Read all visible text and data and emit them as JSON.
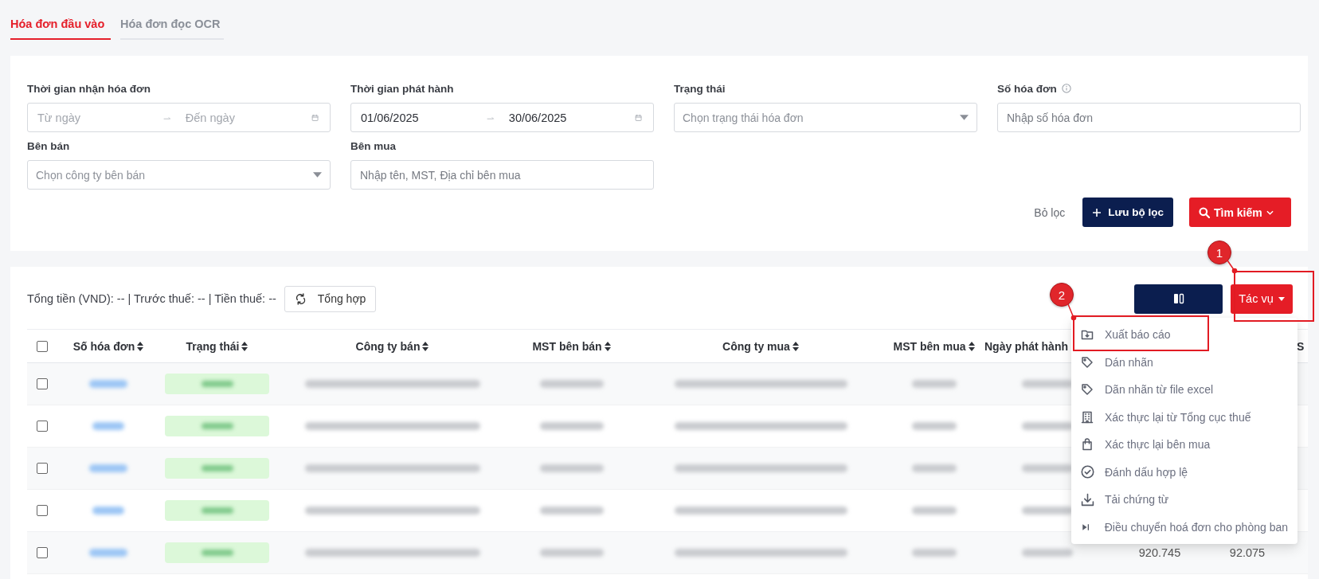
{
  "tabs": [
    {
      "label": "Hóa đơn đầu vào",
      "selected": true
    },
    {
      "label": "Hóa đơn đọc OCR",
      "selected": false
    }
  ],
  "filters": [
    {
      "label": "Thời gian nhận hóa đơn",
      "kind": "daterange",
      "from": {
        "placeholder": "Từ ngày"
      },
      "to": {
        "placeholder": "Đến ngày"
      }
    },
    {
      "label": "Thời gian phát hành",
      "kind": "daterange",
      "from": {
        "value": "01/06/2025"
      },
      "to": {
        "value": "30/06/2025"
      }
    },
    {
      "label": "Trạng thái",
      "kind": "select",
      "placeholder": "Chọn trạng thái hóa đơn"
    },
    {
      "label": "Số hóa đơn",
      "kind": "text",
      "placeholder": "Nhập số hóa đơn",
      "info_icon": true
    },
    {
      "label": "Bên bán",
      "kind": "select",
      "placeholder": "Chọn công ty bên bán"
    },
    {
      "label": "Bên mua",
      "kind": "text",
      "placeholder": "Nhập tên, MST, Địa chỉ bên mua"
    }
  ],
  "filter_actions": [
    {
      "label": "Bỏ lọc",
      "kind": "plain"
    },
    {
      "label": "Lưu bộ lọc",
      "kind": "save"
    },
    {
      "label": "Tìm kiếm",
      "kind": "search"
    }
  ],
  "summary": {
    "text": "Tổng tiền (VND): -- | Trước thuế: -- | Tiền thuế: --",
    "button": "Tổng hợp"
  },
  "actions_button": {
    "label": "Tác vụ"
  },
  "table": {
    "select_all": {
      "checked": false
    },
    "columns": [
      {
        "label": "Số hóa đơn",
        "kind": "link",
        "sortable": true
      },
      {
        "label": "Trạng thái",
        "kind": "status",
        "sortable": true
      },
      {
        "label": "Công ty bán",
        "kind": "text",
        "sortable": true
      },
      {
        "label": "MST bên bán",
        "kind": "text",
        "sortable": true
      },
      {
        "label": "Công ty mua",
        "kind": "text",
        "sortable": true
      },
      {
        "label": "MST bên mua",
        "kind": "text",
        "sortable": true
      },
      {
        "label": "Ngày phát hành",
        "kind": "text",
        "sortable": false
      },
      {
        "kind": "amount"
      },
      {
        "kind": "amount"
      },
      {
        "label": "S",
        "kind": "cut"
      }
    ],
    "rows": [
      {
        "checked": false
      },
      {
        "checked": false
      },
      {
        "checked": false
      },
      {
        "checked": false
      },
      {
        "checked": false,
        "amounts": [
          "920.745",
          "92.075"
        ]
      }
    ]
  },
  "menu": {
    "items": [
      {
        "label": "Xuất báo cáo"
      },
      {
        "label": "Dán nhãn"
      },
      {
        "label": "Dãn nhãn từ file excel"
      },
      {
        "label": "Xác thực lại từ Tổng cục thuế"
      },
      {
        "label": "Xác thực lại bên mua"
      },
      {
        "label": "Đánh dấu hợp lệ"
      },
      {
        "label": "Tải chứng từ"
      },
      {
        "label": "Điều chuyển hoá đơn cho phòng ban"
      }
    ]
  },
  "annotations": [
    {
      "label": "1"
    },
    {
      "label": "2"
    }
  ]
}
